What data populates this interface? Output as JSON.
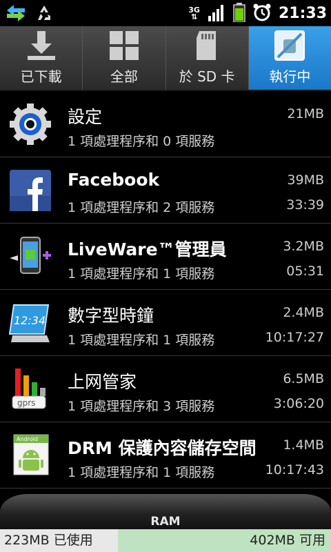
{
  "status_bar": {
    "network": "3G",
    "time": "21:33"
  },
  "tabs": [
    {
      "label": "已下載",
      "active": false
    },
    {
      "label": "全部",
      "active": false
    },
    {
      "label": "於 SD 卡",
      "active": false
    },
    {
      "label": "執行中",
      "active": true
    }
  ],
  "apps": [
    {
      "name": "設定",
      "detail": "1 項處理程序和 0 項服務",
      "size": "21MB",
      "time": ""
    },
    {
      "name": "Facebook",
      "detail": "1 項處理程序和 2 項服務",
      "size": "39MB",
      "time": "33:39"
    },
    {
      "name": "LiveWare™管理員",
      "detail": "1 項處理程序和 1 項服務",
      "size": "3.2MB",
      "time": "05:31"
    },
    {
      "name": "數字型時鐘",
      "detail": "1 項處理程序和 1 項服務",
      "size": "2.4MB",
      "time": "10:17:27"
    },
    {
      "name": "上网管家",
      "detail": "1 項處理程序和 3 項服務",
      "size": "6.5MB",
      "time": "3:06:20"
    },
    {
      "name": "DRM 保護內容儲存空間",
      "detail": "1 項處理程序和 1 項服務",
      "size": "1.4MB",
      "time": "10:17:43"
    }
  ],
  "ram": {
    "label": "RAM",
    "used": "223MB 已使用",
    "free": "402MB 可用",
    "used_fraction": 0.357
  },
  "icon_texts": {
    "clock_display": "12:34",
    "gprs": "gprs",
    "android": "Android"
  }
}
